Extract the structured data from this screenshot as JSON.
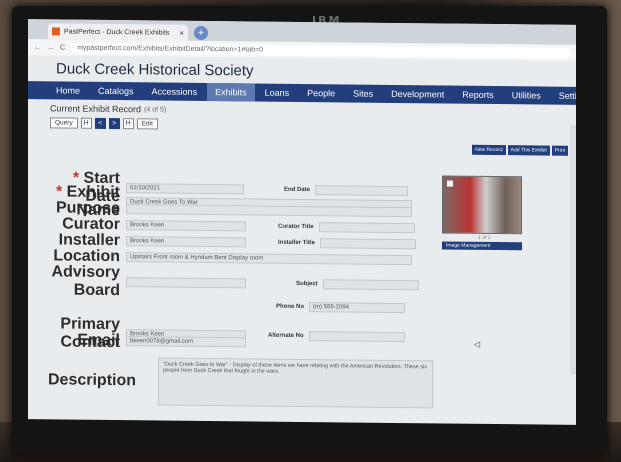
{
  "monitor": {
    "brand": "IBM"
  },
  "browser": {
    "tab_title": "PastPerfect - Duck Creek Exhibits",
    "tab_close": "×",
    "new_tab": "+",
    "url": "mypastperfect.com/Exhibits/ExhibitDetail/?location=1#tab=0",
    "back": "←",
    "forward": "→",
    "reload": "C"
  },
  "app": {
    "title": "Duck Creek Historical Society"
  },
  "nav": {
    "items": [
      "Home",
      "Catalogs",
      "Accessions",
      "Exhibits",
      "Loans",
      "People",
      "Sites",
      "Development",
      "Reports",
      "Utilities",
      "Settings"
    ],
    "active": "Exhibits",
    "search_icon": "search-icon",
    "user_icon": "user-icon",
    "settings_icon": "gear-icon"
  },
  "subheader": {
    "title": "Current Exhibit Record",
    "record": "(4 of 5)"
  },
  "toolbar": {
    "query": "Query",
    "first": "H",
    "prev": "<",
    "next": ">",
    "last": "H",
    "edit": "Edit"
  },
  "right_buttons": [
    "New Record",
    "Add This Exhibit",
    "Print"
  ],
  "form": {
    "start_date_label": "Start Date",
    "start_date": "01/10/2021",
    "end_date_label": "End Date",
    "end_date": "",
    "exhibit_name_label": "Exhibit Name",
    "exhibit_name": "Duck Creek Goes To War",
    "purpose_label": "Purpose",
    "purpose": "",
    "curator_label": "Curator",
    "curator": "Brooks Keen",
    "curator_title_label": "Curator Title",
    "installer_label": "Installer",
    "installer": "Brooks Keen",
    "installer_title_label": "Installer Title",
    "location_label": "Location",
    "location": "Upstairs Front room & Hyndam Bent Display room",
    "advisory_board_label": "Advisory Board",
    "advisory_board": "",
    "subject_label": "Subject",
    "phone_label": "Phone No",
    "phone": "(m) 555-2094",
    "alternate_label": "Alternate No",
    "primary_contact_label": "Primary Contact",
    "primary_contact": "Brooks Keen",
    "email_label": "Email",
    "email": "bkeen0078@gmail.com",
    "description_label": "Description",
    "description": "\"Duck Creek Goes to War\" - Display of these items we have relating with the American Revolution. These six people from Duck Creek that fought in the wars."
  },
  "image": {
    "caption": "1 of 1",
    "button": "Image Management"
  }
}
